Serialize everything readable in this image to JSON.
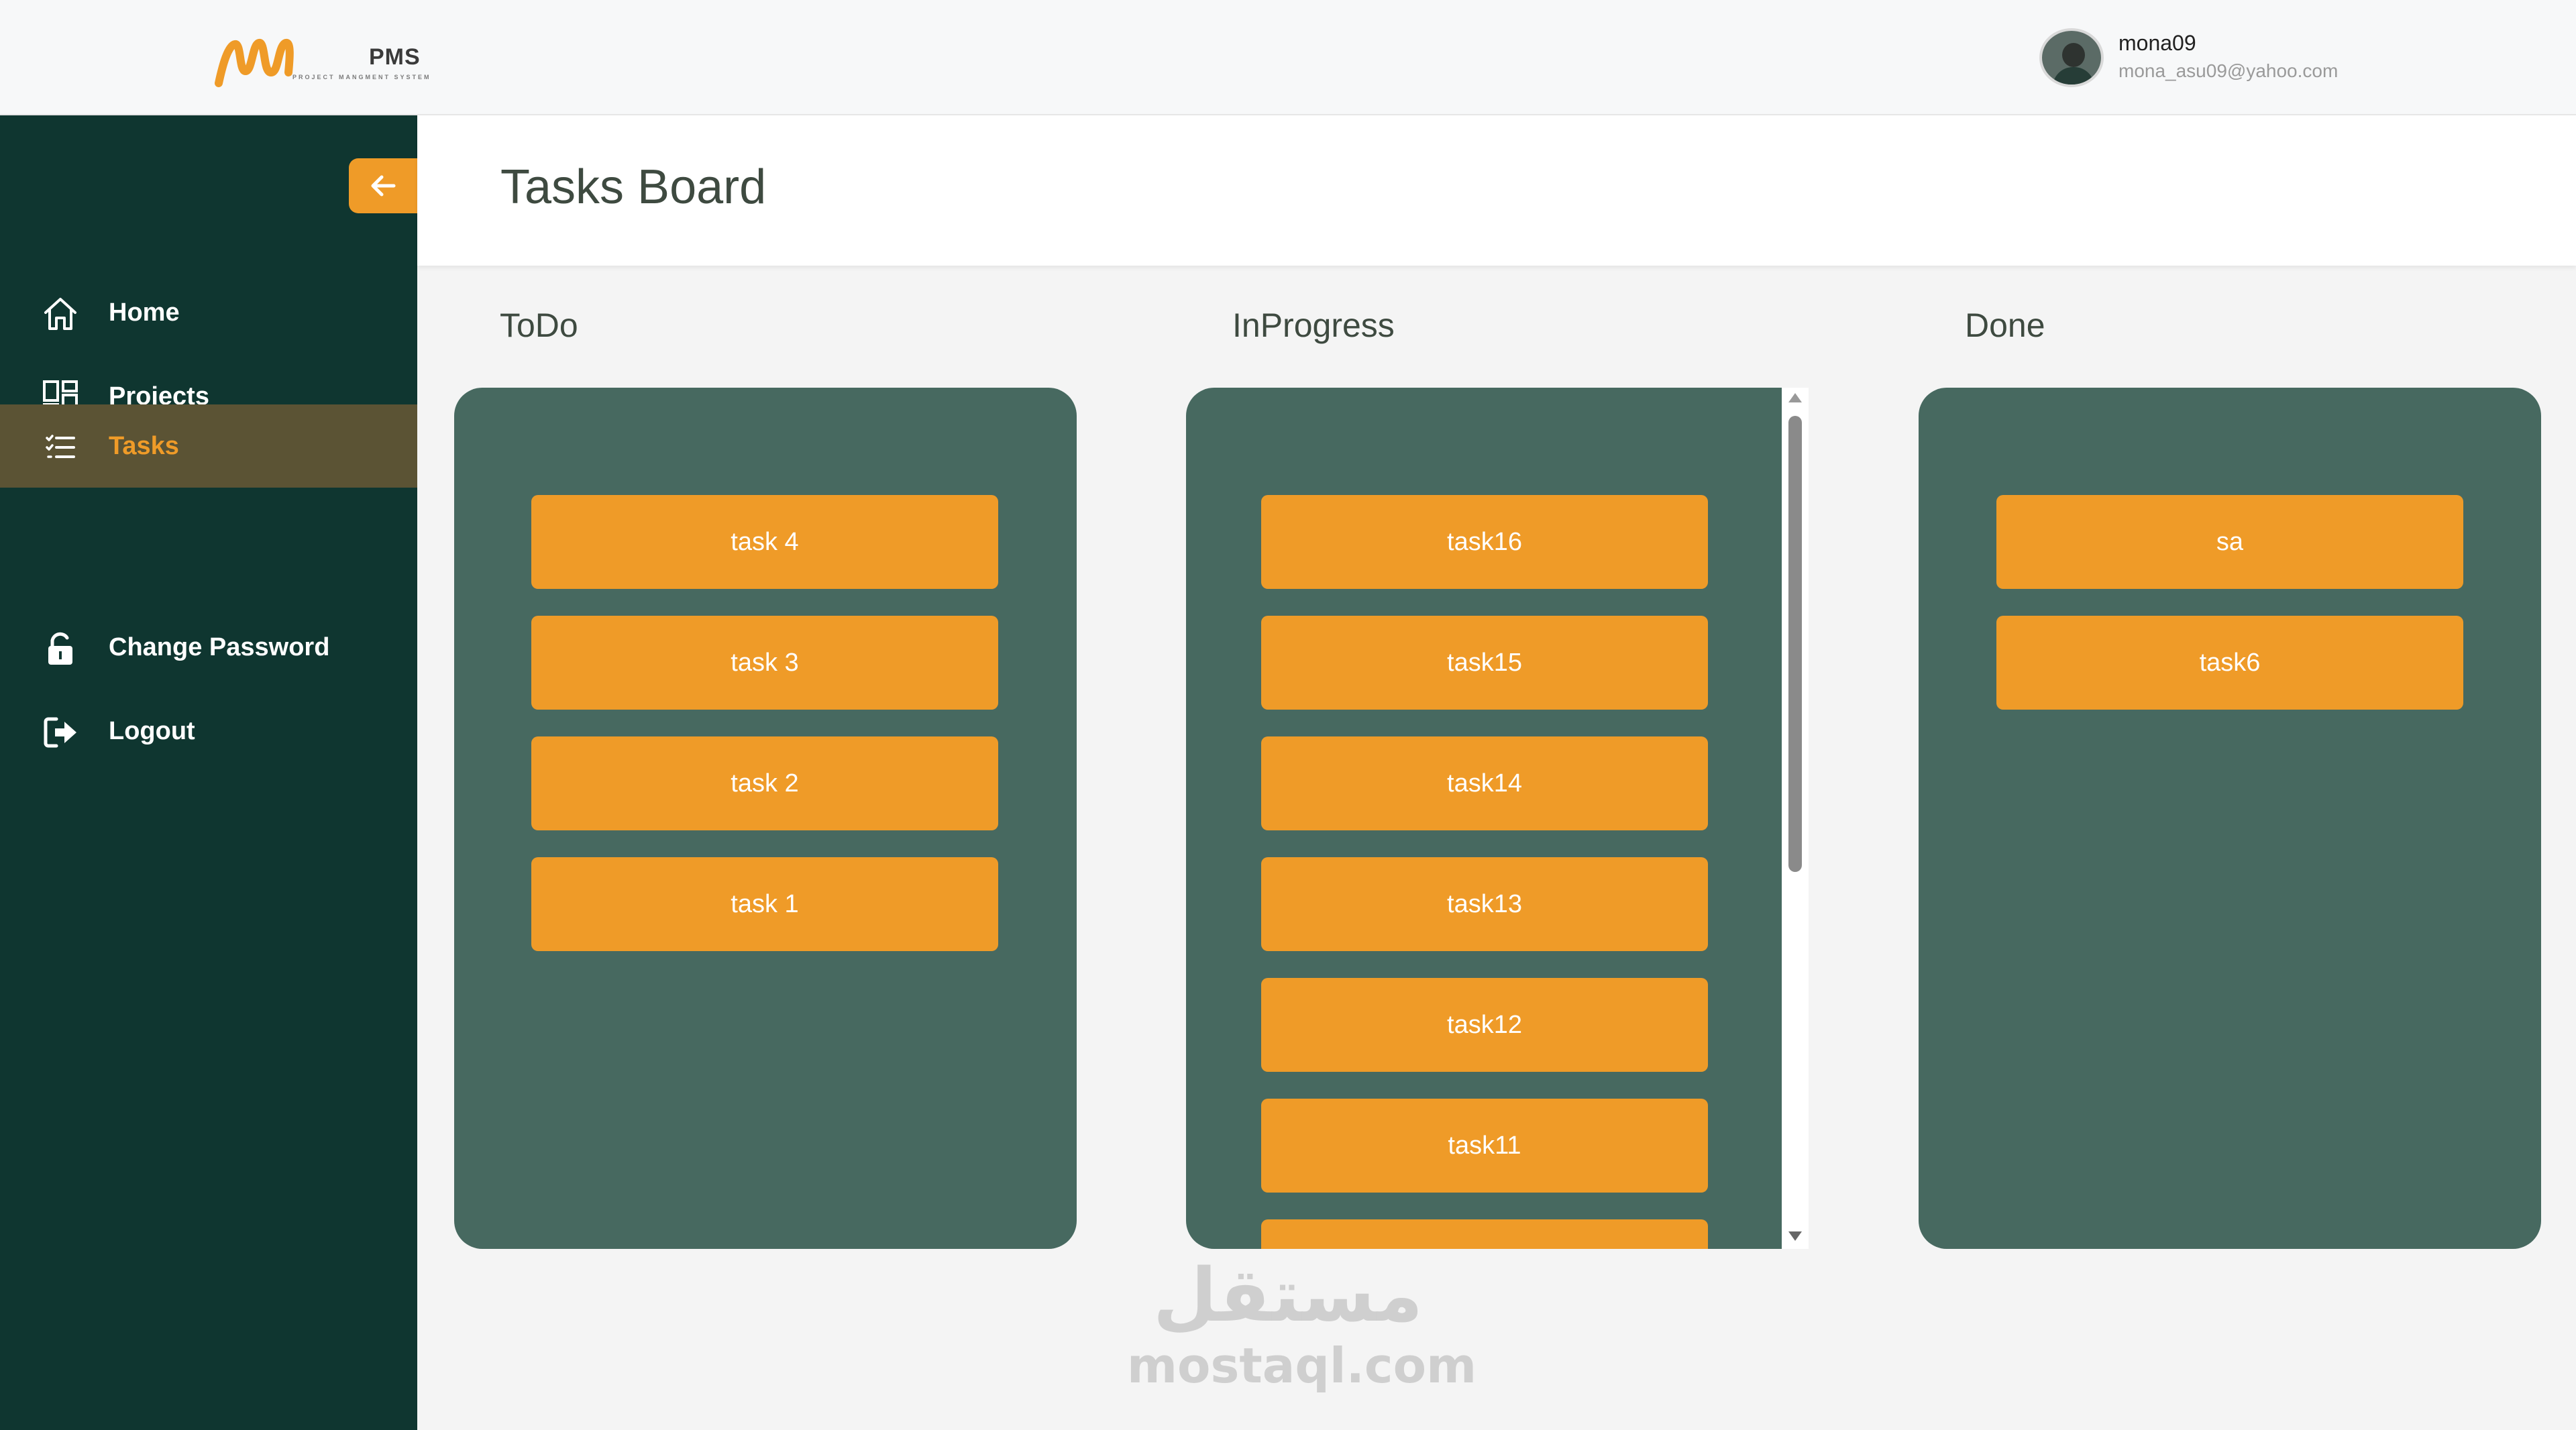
{
  "brand": {
    "name": "PMS",
    "subtitle": "PROJECT MANGMENT SYSTEM",
    "accent": "#ef9b28"
  },
  "user": {
    "username": "mona09",
    "email": "mona_asu09@yahoo.com"
  },
  "sidebar": {
    "collapse_icon": "arrow-left-icon",
    "items": [
      {
        "label": "Home",
        "icon": "home-icon"
      },
      {
        "label": "Projects",
        "icon": "grid-icon"
      },
      {
        "label": "Tasks",
        "icon": "list-icon",
        "active": true
      },
      {
        "label": "Change Password",
        "icon": "lock-icon"
      },
      {
        "label": "Logout",
        "icon": "logout-icon"
      }
    ]
  },
  "page": {
    "title": "Tasks Board"
  },
  "board": {
    "columns": [
      {
        "title": "ToDo",
        "tasks": [
          "task 4",
          "task 3",
          "task 2",
          "task 1"
        ]
      },
      {
        "title": "InProgress",
        "tasks": [
          "task16",
          "task15",
          "task14",
          "task13",
          "task12",
          "task11",
          ""
        ]
      },
      {
        "title": "Done",
        "tasks": [
          "sa",
          "task6"
        ]
      }
    ]
  },
  "watermark": {
    "arabic": "مستقل",
    "latin": "mostaql.com"
  },
  "colors": {
    "sidebar_bg": "#0f3630",
    "active_item_bg": "#5b5334",
    "column_bg": "#476960",
    "card_bg": "#ef9b28"
  }
}
